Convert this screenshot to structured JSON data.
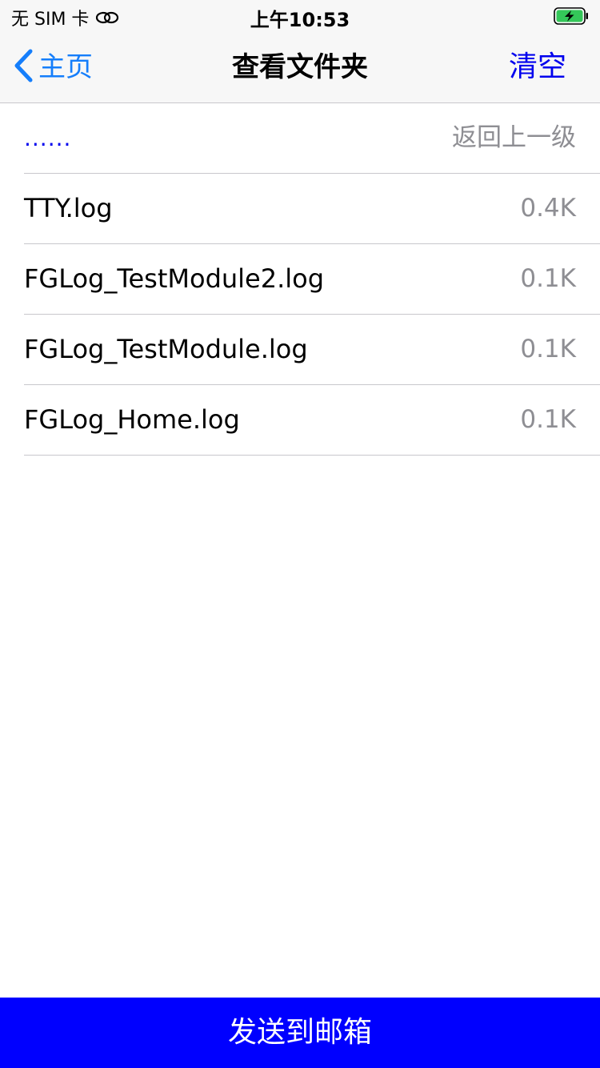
{
  "status_bar": {
    "carrier": "无 SIM 卡",
    "time": "上午10:53",
    "icons": [
      "link-icon",
      "battery-charging-icon"
    ],
    "battery_color": "#34c759"
  },
  "nav": {
    "back_label": "主页",
    "title": "查看文件夹",
    "right_label": "清空",
    "back_color": "#157efb",
    "right_color": "#0000ee"
  },
  "files": [
    {
      "name": "......",
      "detail": "返回上一级"
    },
    {
      "name": "TTY.log",
      "detail": "0.4K"
    },
    {
      "name": "FGLog_TestModule2.log",
      "detail": "0.1K"
    },
    {
      "name": "FGLog_TestModule.log",
      "detail": "0.1K"
    },
    {
      "name": "FGLog_Home.log",
      "detail": "0.1K"
    }
  ],
  "send_button": {
    "label": "发送到邮箱",
    "background": "#0000ff"
  }
}
